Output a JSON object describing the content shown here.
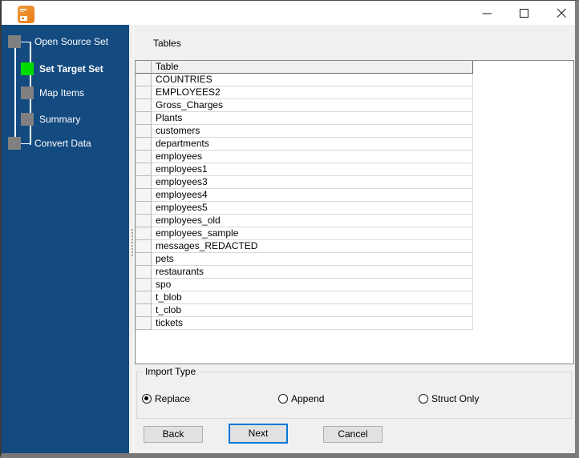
{
  "window": {
    "controls": {
      "minimize": "minimize",
      "maximize": "maximize",
      "close": "close"
    }
  },
  "wizard_steps": [
    {
      "label": "Open Source Set",
      "state": "done"
    },
    {
      "label": "Set Target Set",
      "state": "active"
    },
    {
      "label": "Map Items",
      "state": "pending"
    },
    {
      "label": "Summary",
      "state": "pending"
    },
    {
      "label": "Convert Data",
      "state": "pending"
    }
  ],
  "main": {
    "section_label": "Tables",
    "table": {
      "header": "Table",
      "rows": [
        "COUNTRIES",
        "EMPLOYEES2",
        "Gross_Charges",
        "Plants",
        "customers",
        "departments",
        "employees",
        "employees1",
        "employees3",
        "employees4",
        "employees5",
        "employees_old",
        "employees_sample",
        "messages_REDACTED",
        "pets",
        "restaurants",
        "spo",
        "t_blob",
        "t_clob",
        "tickets"
      ]
    },
    "import_type": {
      "legend": "Import Type",
      "options": [
        {
          "label": "Replace",
          "selected": true
        },
        {
          "label": "Append",
          "selected": false
        },
        {
          "label": "Struct Only",
          "selected": false
        }
      ]
    },
    "buttons": {
      "back": "Back",
      "next": "Next",
      "cancel": "Cancel"
    }
  },
  "colors": {
    "sidebar_bg": "#134a80",
    "active_step": "#00dc00",
    "focus_accent": "#0078d7",
    "step_square": "#808080"
  }
}
